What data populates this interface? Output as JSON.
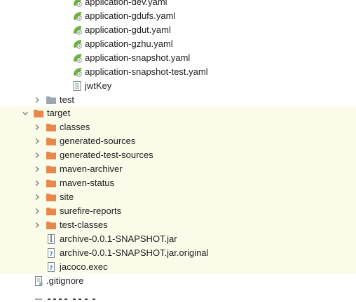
{
  "tree": {
    "yaml_files": [
      {
        "label": "application-dev.yaml"
      },
      {
        "label": "application-gdufs.yaml"
      },
      {
        "label": "application-gdut.yaml"
      },
      {
        "label": "application-gzhu.yaml"
      },
      {
        "label": "application-snapshot.yaml"
      },
      {
        "label": "application-snapshot-test.yaml"
      }
    ],
    "jwt_key": {
      "label": "jwtKey"
    },
    "test_folder": {
      "label": "test"
    },
    "target_folder": {
      "label": "target",
      "children": [
        {
          "label": "classes"
        },
        {
          "label": "generated-sources"
        },
        {
          "label": "generated-test-sources"
        },
        {
          "label": "maven-archiver"
        },
        {
          "label": "maven-status"
        },
        {
          "label": "site"
        },
        {
          "label": "surefire-reports"
        },
        {
          "label": "test-classes"
        }
      ],
      "files": [
        {
          "label": "archive-0.0.1-SNAPSHOT.jar",
          "icon": "jar-file-icon"
        },
        {
          "label": "archive-0.0.1-SNAPSHOT.jar.original",
          "icon": "unknown-file-icon"
        },
        {
          "label": "jacoco.exec",
          "icon": "unknown-file-icon"
        }
      ]
    },
    "gitignore": {
      "label": ".gitignore"
    }
  },
  "colors": {
    "excluded_bg": "#fbfbe9",
    "folder_gray": "#9aa7b0",
    "folder_orange": "#e8874a",
    "spring_green": "#6db33f",
    "arrow": "#7a7a7a"
  }
}
